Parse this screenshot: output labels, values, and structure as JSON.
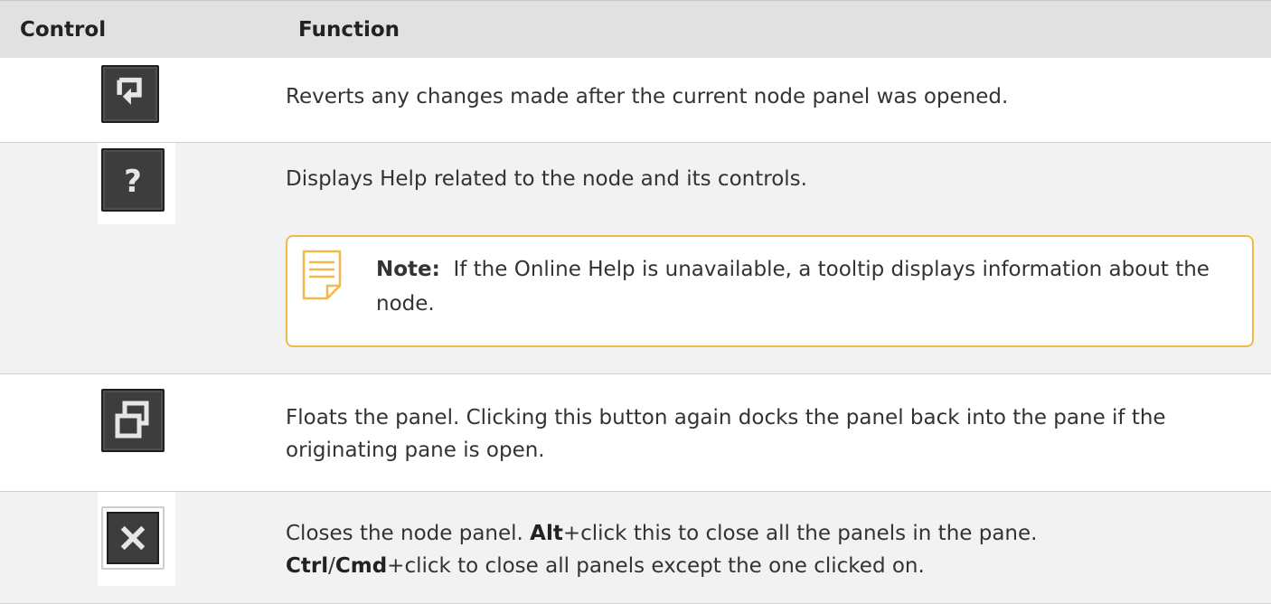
{
  "table": {
    "headers": {
      "control": "Control",
      "function": "Function"
    },
    "rows": [
      {
        "icon": "revert-icon",
        "text": "Reverts any changes made after the current node panel was opened."
      },
      {
        "icon": "help-icon",
        "text": "Displays Help related to the node and its controls.",
        "note": {
          "icon": "note-icon",
          "label": "Note:",
          "text": "If the Online Help is unavailable, a tooltip displays information about the node."
        }
      },
      {
        "icon": "float-panel-icon",
        "text": "Floats the panel. Clicking this button again docks the panel back into the pane if the originating pane is open."
      },
      {
        "icon": "close-icon",
        "line1": {
          "key1": "Alt",
          "pre": "Closes the node panel. ",
          "post": "+click this to close all the panels in the pane."
        },
        "line2": {
          "key1": "Ctrl",
          "sep": "/",
          "key2": "Cmd",
          "post": "+click to close all panels except the one clicked on."
        }
      }
    ]
  },
  "colors": {
    "header_bg": "#e1e1e1",
    "row_alt_bg": "#f2f2f2",
    "note_border": "#f2b94a",
    "icon_button_bg": "#3d3d3d"
  }
}
